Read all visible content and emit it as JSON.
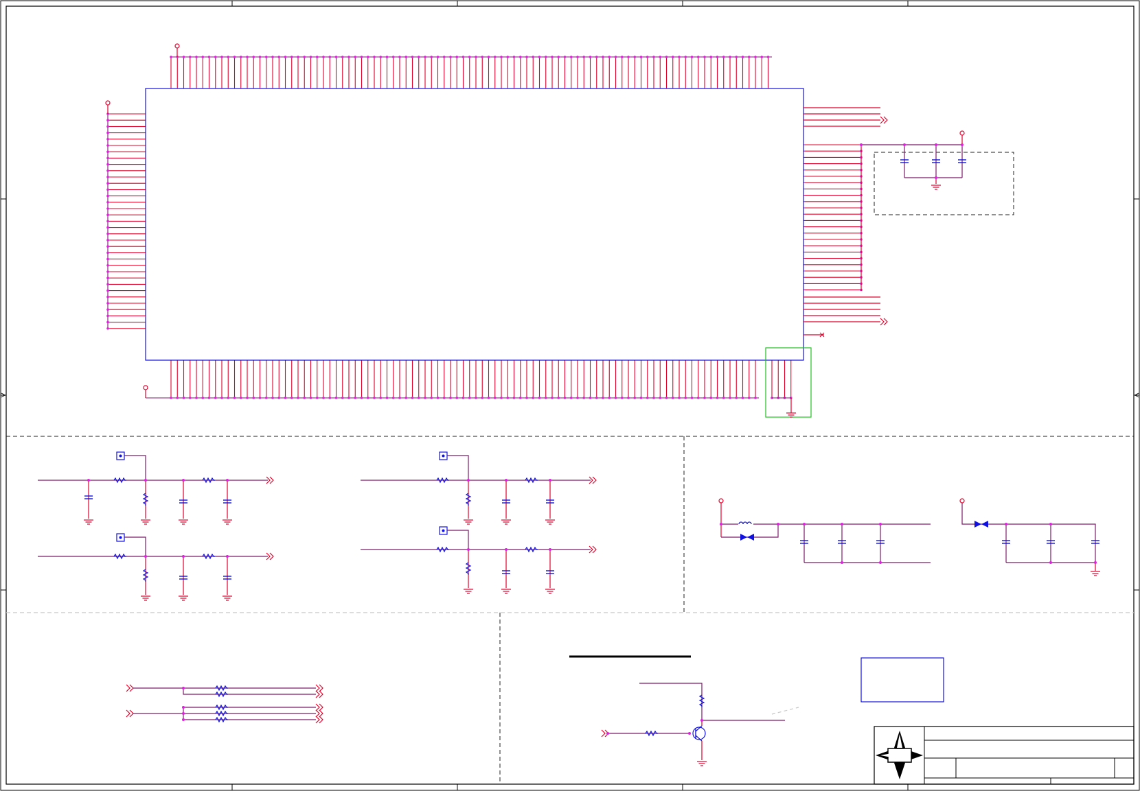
{
  "sheet": {
    "colors": {
      "wire": "#e0002a",
      "bus": "#7a1a6a",
      "junction": "#e020e0",
      "component": "#1010e0",
      "border": "#000000",
      "section_line": "#222222",
      "section_line_light": "#c8c8c8",
      "highlight": "#20c020",
      "ground": "#e0002a"
    },
    "main_ic": {
      "present": true
    },
    "decoupling_group": {
      "capacitor_count": 3
    },
    "rc_filters": {
      "count": 4
    },
    "power_filters": {
      "count": 2
    },
    "resistor_arrays": {
      "count": 2
    },
    "transistor_driver": {
      "present": true
    },
    "note_box": {
      "text": ""
    },
    "title_block": {
      "logo_icon": "compass-star-icon",
      "title": "",
      "document_number": "",
      "revision": "",
      "sheet": ""
    }
  }
}
